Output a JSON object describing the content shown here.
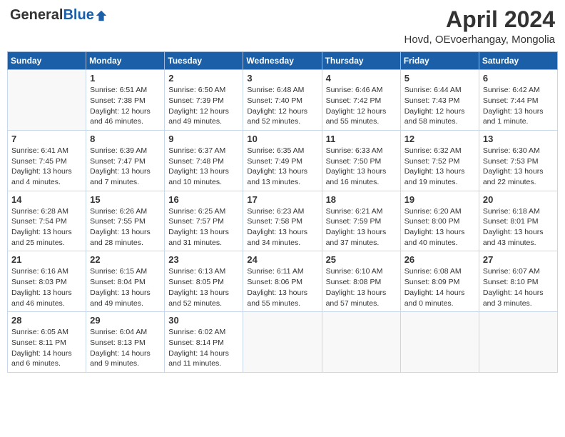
{
  "header": {
    "logo_general": "General",
    "logo_blue": "Blue",
    "month_year": "April 2024",
    "location": "Hovd, OEvoerhangay, Mongolia"
  },
  "days_of_week": [
    "Sunday",
    "Monday",
    "Tuesday",
    "Wednesday",
    "Thursday",
    "Friday",
    "Saturday"
  ],
  "weeks": [
    [
      {
        "day": "",
        "info": ""
      },
      {
        "day": "1",
        "info": "Sunrise: 6:51 AM\nSunset: 7:38 PM\nDaylight: 12 hours\nand 46 minutes."
      },
      {
        "day": "2",
        "info": "Sunrise: 6:50 AM\nSunset: 7:39 PM\nDaylight: 12 hours\nand 49 minutes."
      },
      {
        "day": "3",
        "info": "Sunrise: 6:48 AM\nSunset: 7:40 PM\nDaylight: 12 hours\nand 52 minutes."
      },
      {
        "day": "4",
        "info": "Sunrise: 6:46 AM\nSunset: 7:42 PM\nDaylight: 12 hours\nand 55 minutes."
      },
      {
        "day": "5",
        "info": "Sunrise: 6:44 AM\nSunset: 7:43 PM\nDaylight: 12 hours\nand 58 minutes."
      },
      {
        "day": "6",
        "info": "Sunrise: 6:42 AM\nSunset: 7:44 PM\nDaylight: 13 hours\nand 1 minute."
      }
    ],
    [
      {
        "day": "7",
        "info": "Sunrise: 6:41 AM\nSunset: 7:45 PM\nDaylight: 13 hours\nand 4 minutes."
      },
      {
        "day": "8",
        "info": "Sunrise: 6:39 AM\nSunset: 7:47 PM\nDaylight: 13 hours\nand 7 minutes."
      },
      {
        "day": "9",
        "info": "Sunrise: 6:37 AM\nSunset: 7:48 PM\nDaylight: 13 hours\nand 10 minutes."
      },
      {
        "day": "10",
        "info": "Sunrise: 6:35 AM\nSunset: 7:49 PM\nDaylight: 13 hours\nand 13 minutes."
      },
      {
        "day": "11",
        "info": "Sunrise: 6:33 AM\nSunset: 7:50 PM\nDaylight: 13 hours\nand 16 minutes."
      },
      {
        "day": "12",
        "info": "Sunrise: 6:32 AM\nSunset: 7:52 PM\nDaylight: 13 hours\nand 19 minutes."
      },
      {
        "day": "13",
        "info": "Sunrise: 6:30 AM\nSunset: 7:53 PM\nDaylight: 13 hours\nand 22 minutes."
      }
    ],
    [
      {
        "day": "14",
        "info": "Sunrise: 6:28 AM\nSunset: 7:54 PM\nDaylight: 13 hours\nand 25 minutes."
      },
      {
        "day": "15",
        "info": "Sunrise: 6:26 AM\nSunset: 7:55 PM\nDaylight: 13 hours\nand 28 minutes."
      },
      {
        "day": "16",
        "info": "Sunrise: 6:25 AM\nSunset: 7:57 PM\nDaylight: 13 hours\nand 31 minutes."
      },
      {
        "day": "17",
        "info": "Sunrise: 6:23 AM\nSunset: 7:58 PM\nDaylight: 13 hours\nand 34 minutes."
      },
      {
        "day": "18",
        "info": "Sunrise: 6:21 AM\nSunset: 7:59 PM\nDaylight: 13 hours\nand 37 minutes."
      },
      {
        "day": "19",
        "info": "Sunrise: 6:20 AM\nSunset: 8:00 PM\nDaylight: 13 hours\nand 40 minutes."
      },
      {
        "day": "20",
        "info": "Sunrise: 6:18 AM\nSunset: 8:01 PM\nDaylight: 13 hours\nand 43 minutes."
      }
    ],
    [
      {
        "day": "21",
        "info": "Sunrise: 6:16 AM\nSunset: 8:03 PM\nDaylight: 13 hours\nand 46 minutes."
      },
      {
        "day": "22",
        "info": "Sunrise: 6:15 AM\nSunset: 8:04 PM\nDaylight: 13 hours\nand 49 minutes."
      },
      {
        "day": "23",
        "info": "Sunrise: 6:13 AM\nSunset: 8:05 PM\nDaylight: 13 hours\nand 52 minutes."
      },
      {
        "day": "24",
        "info": "Sunrise: 6:11 AM\nSunset: 8:06 PM\nDaylight: 13 hours\nand 55 minutes."
      },
      {
        "day": "25",
        "info": "Sunrise: 6:10 AM\nSunset: 8:08 PM\nDaylight: 13 hours\nand 57 minutes."
      },
      {
        "day": "26",
        "info": "Sunrise: 6:08 AM\nSunset: 8:09 PM\nDaylight: 14 hours\nand 0 minutes."
      },
      {
        "day": "27",
        "info": "Sunrise: 6:07 AM\nSunset: 8:10 PM\nDaylight: 14 hours\nand 3 minutes."
      }
    ],
    [
      {
        "day": "28",
        "info": "Sunrise: 6:05 AM\nSunset: 8:11 PM\nDaylight: 14 hours\nand 6 minutes."
      },
      {
        "day": "29",
        "info": "Sunrise: 6:04 AM\nSunset: 8:13 PM\nDaylight: 14 hours\nand 9 minutes."
      },
      {
        "day": "30",
        "info": "Sunrise: 6:02 AM\nSunset: 8:14 PM\nDaylight: 14 hours\nand 11 minutes."
      },
      {
        "day": "",
        "info": ""
      },
      {
        "day": "",
        "info": ""
      },
      {
        "day": "",
        "info": ""
      },
      {
        "day": "",
        "info": ""
      }
    ]
  ]
}
